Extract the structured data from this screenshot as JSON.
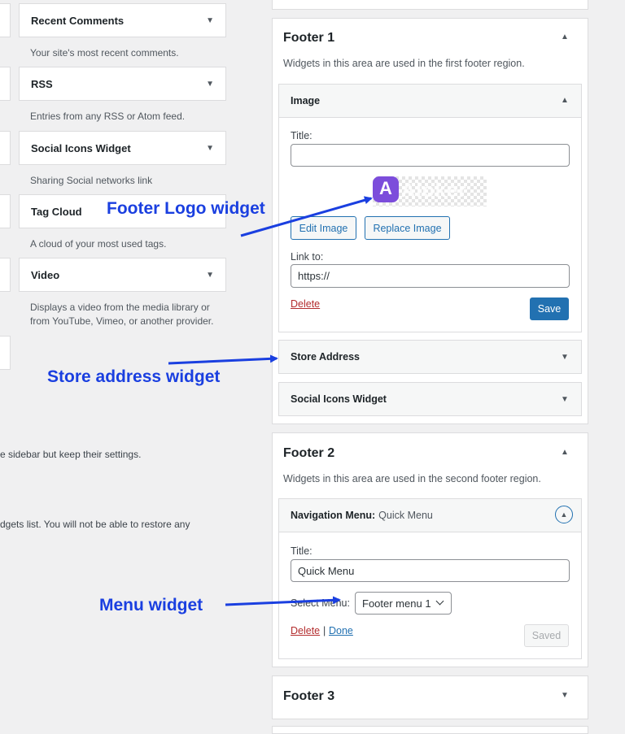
{
  "left": {
    "widgets": [
      {
        "label": "Recent Comments",
        "desc": "Your site's most recent comments."
      },
      {
        "label": "RSS",
        "desc": "Entries from any RSS or Atom feed."
      },
      {
        "label": "Social Icons Widget",
        "desc": "Sharing Social networks link"
      },
      {
        "label": "Tag Cloud",
        "desc": "A cloud of your most used tags."
      },
      {
        "label": "Video",
        "desc_line1": "Displays a video from the media library or",
        "desc_line2": "from YouTube, Vimeo, or another provider."
      }
    ],
    "note1": "e sidebar but keep their settings.",
    "note2": "dgets list. You will not be able to restore any"
  },
  "footer1": {
    "title": "Footer 1",
    "desc": "Widgets in this area are used in the first footer region.",
    "image_widget": {
      "title": "Image",
      "title_label": "Title:",
      "title_value": "",
      "logo_text": "Aloker",
      "edit_image": "Edit Image",
      "replace_image": "Replace Image",
      "link_label": "Link to:",
      "link_value": "https://",
      "delete": "Delete",
      "save": "Save"
    },
    "store_address": "Store Address",
    "social_icons": "Social Icons Widget"
  },
  "footer2": {
    "title": "Footer 2",
    "desc": "Widgets in this area are used in the second footer region.",
    "nav_widget": {
      "title": "Navigation Menu:",
      "subtitle": "Quick Menu",
      "title_label": "Title:",
      "title_value": "Quick Menu",
      "select_label": "Select Menu:",
      "select_value": "Footer menu 1",
      "delete": "Delete",
      "separator": "|",
      "done": "Done",
      "saved": "Saved"
    }
  },
  "footer3": {
    "title": "Footer 3"
  },
  "annotations": {
    "logo": "Footer Logo widget",
    "store": "Store address widget",
    "menu": "Menu widget"
  },
  "colors": {
    "accent": "#2271b1",
    "annotation": "#1a3fe0",
    "delete": "#b32d2e"
  }
}
